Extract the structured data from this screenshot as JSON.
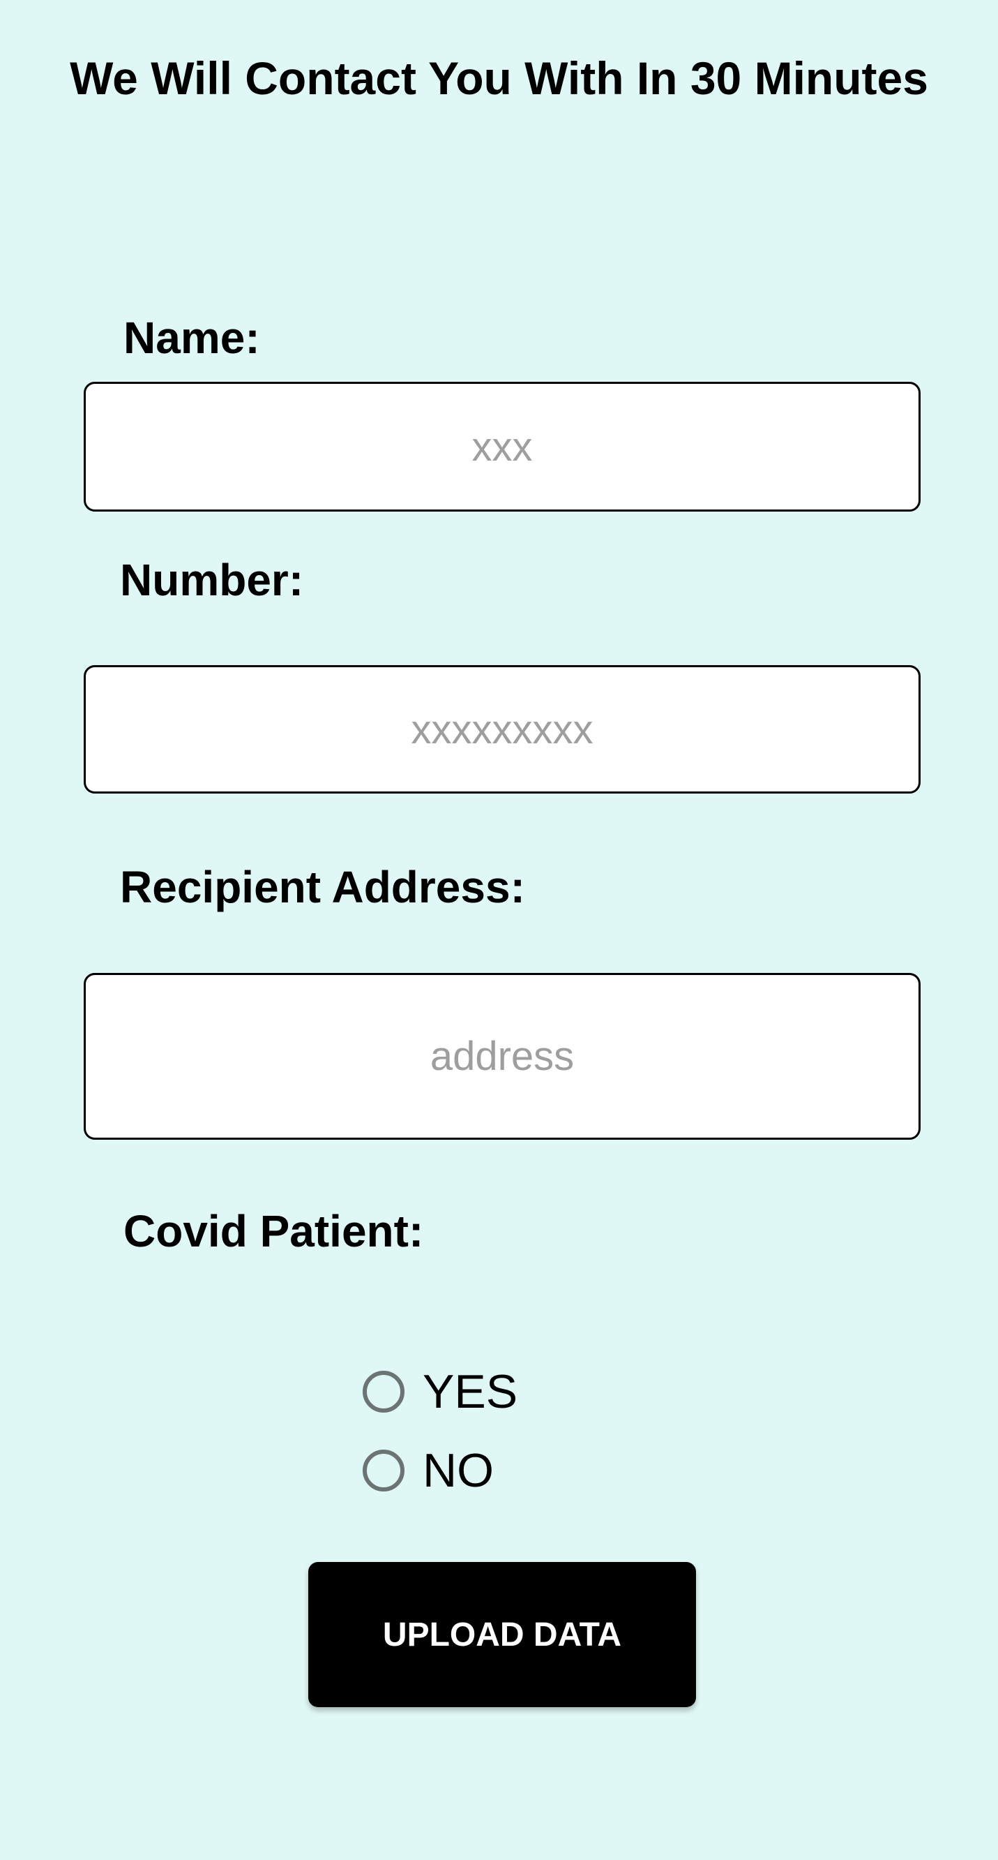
{
  "header": {
    "title": "We Will Contact You With In 30 Minutes"
  },
  "form": {
    "name": {
      "label": "Name:",
      "placeholder": "xxx",
      "value": ""
    },
    "number": {
      "label": "Number:",
      "placeholder": "xxxxxxxxx",
      "value": ""
    },
    "address": {
      "label": "Recipient Address:",
      "placeholder": "address",
      "value": ""
    },
    "covid": {
      "label": "Covid Patient:",
      "options": [
        {
          "label": "YES"
        },
        {
          "label": "NO"
        }
      ]
    },
    "submit_label": "UPLOAD DATA"
  },
  "colors": {
    "background": "#e0f8f5",
    "button": "#000000",
    "placeholder": "#9e9e9e",
    "radio": "#6b7473"
  }
}
